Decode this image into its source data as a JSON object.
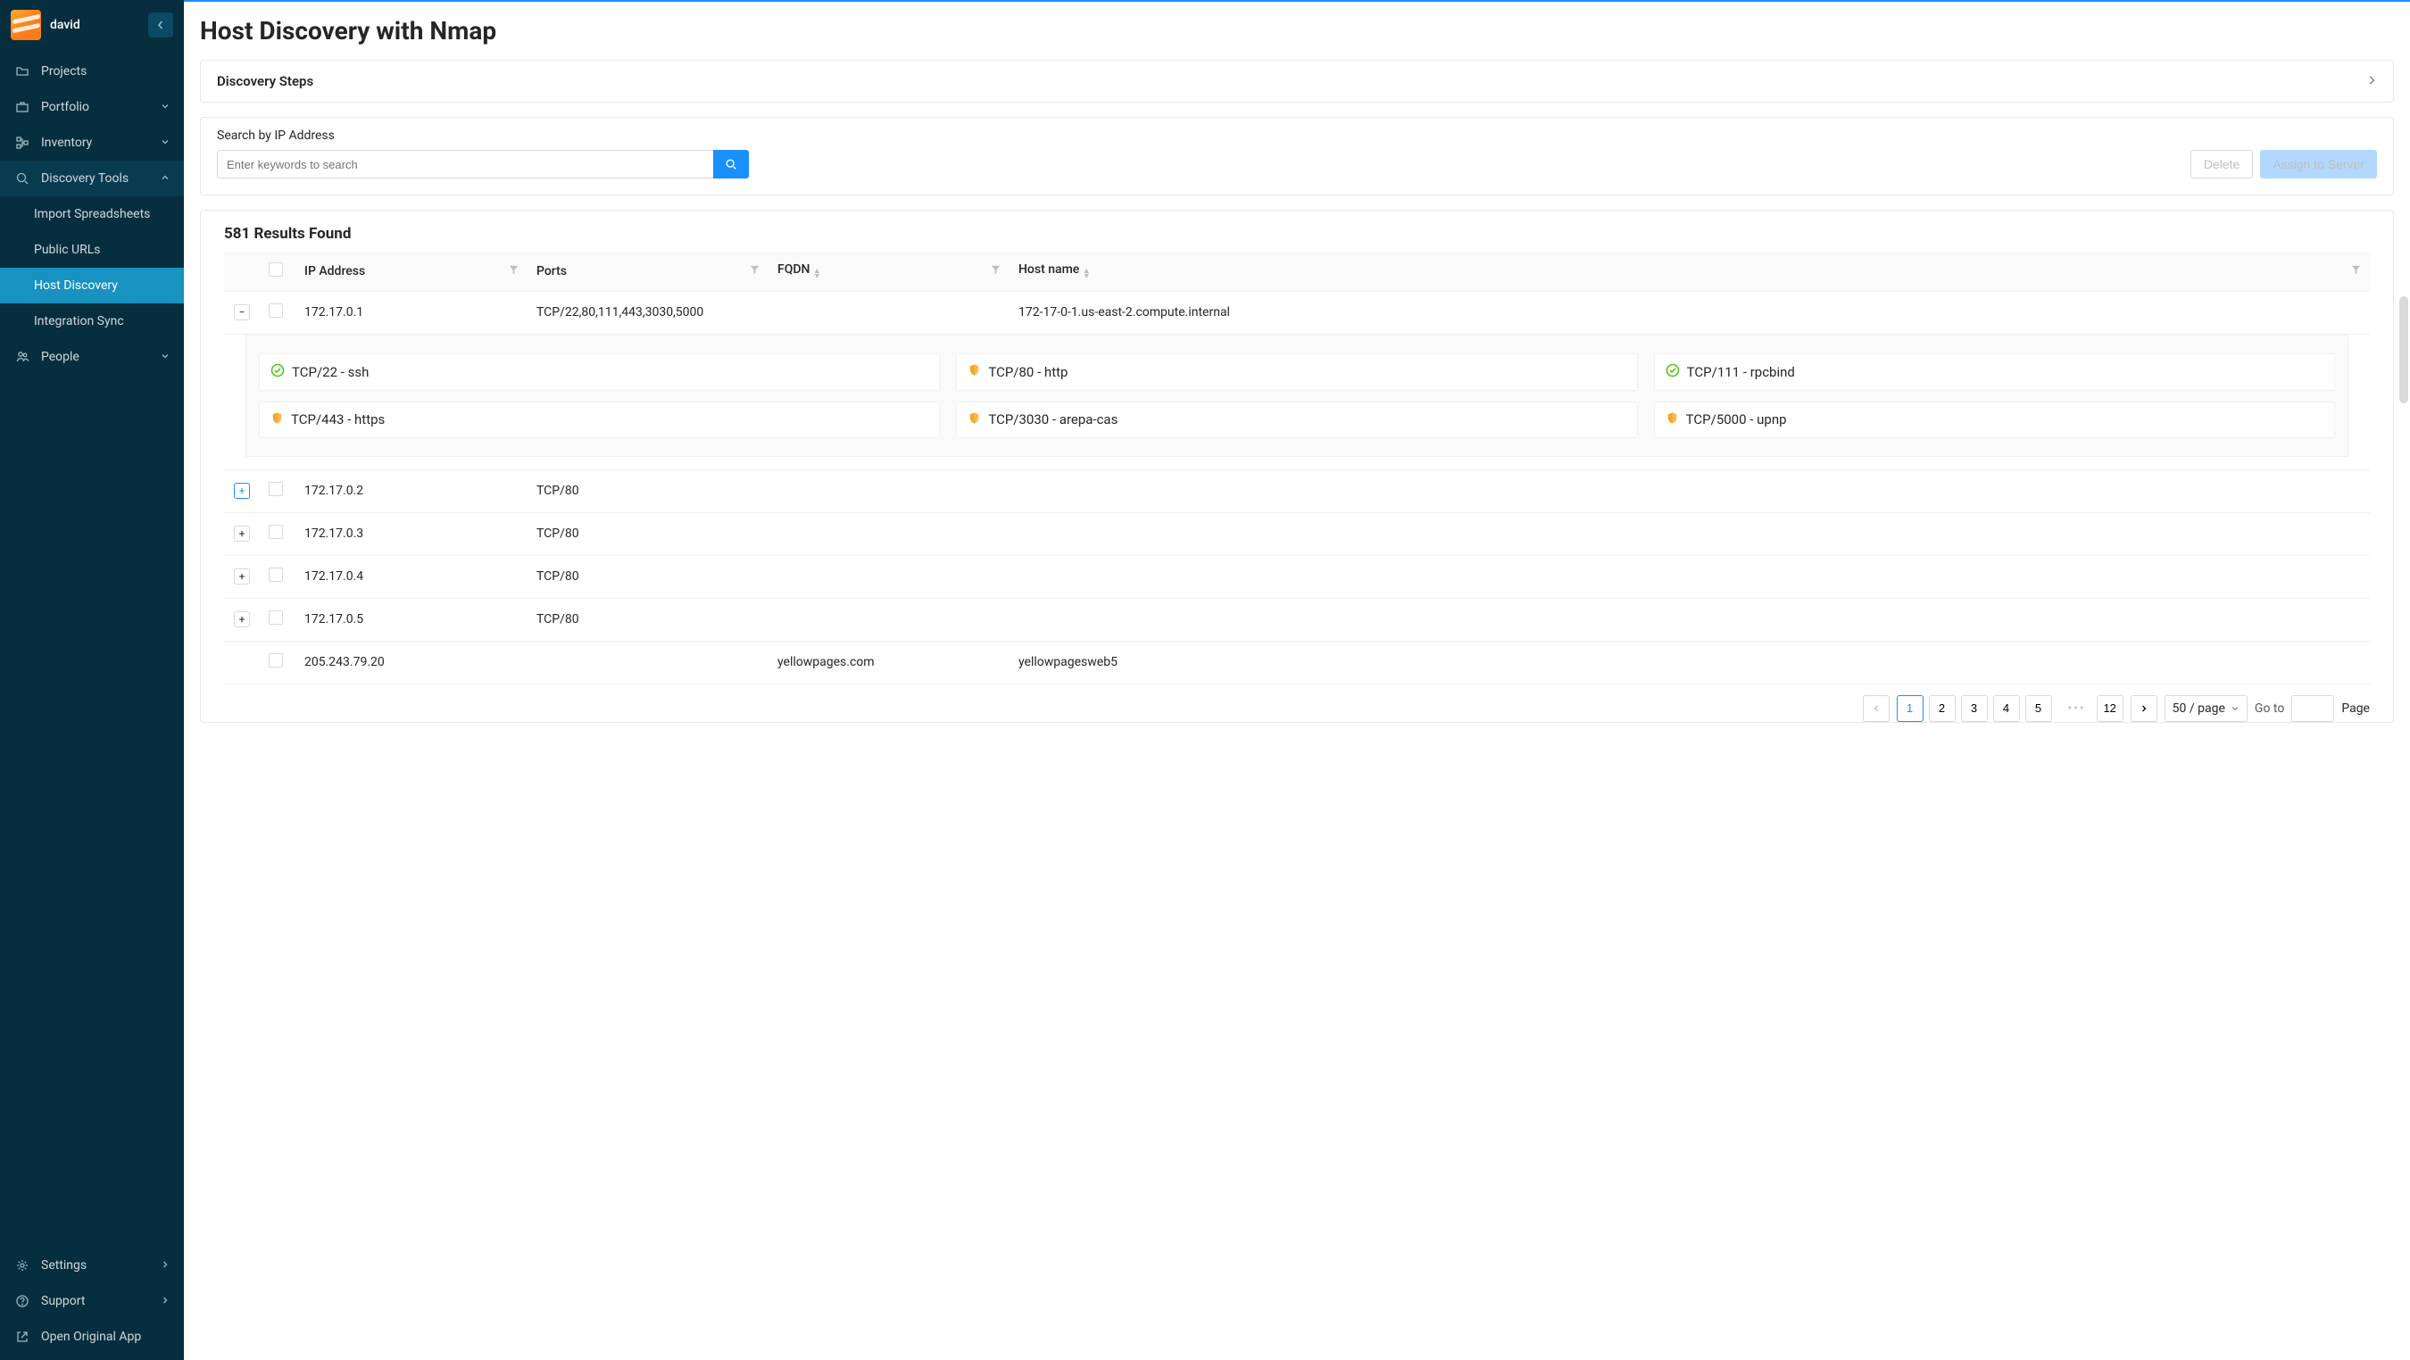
{
  "user": {
    "name": "david"
  },
  "sidebar": {
    "projects": "Projects",
    "portfolio": "Portfolio",
    "inventory": "Inventory",
    "discovery_tools": "Discovery Tools",
    "discovery_subs": {
      "import": "Import Spreadsheets",
      "public_urls": "Public URLs",
      "host_discovery": "Host Discovery",
      "integration_sync": "Integration Sync"
    },
    "people": "People",
    "settings": "Settings",
    "support": "Support",
    "open_app": "Open Original App"
  },
  "page": {
    "title": "Host Discovery with Nmap",
    "discovery_steps": "Discovery Steps"
  },
  "search": {
    "label": "Search by IP Address",
    "placeholder": "Enter keywords to search"
  },
  "actions": {
    "delete": "Delete",
    "assign": "Assign to Server"
  },
  "results": {
    "count_label": "581 Results Found",
    "columns": {
      "ip": "IP Address",
      "ports": "Ports",
      "fqdn": "FQDN",
      "hostname": "Host name"
    },
    "rows": [
      {
        "expanded": true,
        "ip": "172.17.0.1",
        "ports": "TCP/22,80,111,443,3030,5000",
        "fqdn": "",
        "hostname": "172-17-0-1.us-east-2.compute.internal"
      },
      {
        "expanded": false,
        "ip": "172.17.0.2",
        "ports": "TCP/80",
        "fqdn": "",
        "hostname": ""
      },
      {
        "expanded": false,
        "ip": "172.17.0.3",
        "ports": "TCP/80",
        "fqdn": "",
        "hostname": ""
      },
      {
        "expanded": false,
        "ip": "172.17.0.4",
        "ports": "TCP/80",
        "fqdn": "",
        "hostname": ""
      },
      {
        "expanded": false,
        "ip": "172.17.0.5",
        "ports": "TCP/80",
        "fqdn": "",
        "hostname": ""
      },
      {
        "expanded": null,
        "ip": "205.243.79.20",
        "ports": "",
        "fqdn": "yellowpages.com",
        "hostname": "yellowpagesweb5"
      }
    ],
    "expanded_ports": [
      {
        "status": "ok",
        "label": "TCP/22 - ssh"
      },
      {
        "status": "warn",
        "label": "TCP/80 - http"
      },
      {
        "status": "ok",
        "label": "TCP/111 - rpcbind"
      },
      {
        "status": "warn",
        "label": "TCP/443 - https"
      },
      {
        "status": "warn",
        "label": "TCP/3030 - arepa-cas"
      },
      {
        "status": "warn",
        "label": "TCP/5000 - upnp"
      }
    ]
  },
  "pagination": {
    "pages": [
      "1",
      "2",
      "3",
      "4",
      "5"
    ],
    "last": "12",
    "page_size": "50 / page",
    "goto_label": "Go to",
    "page_label": "Page"
  }
}
